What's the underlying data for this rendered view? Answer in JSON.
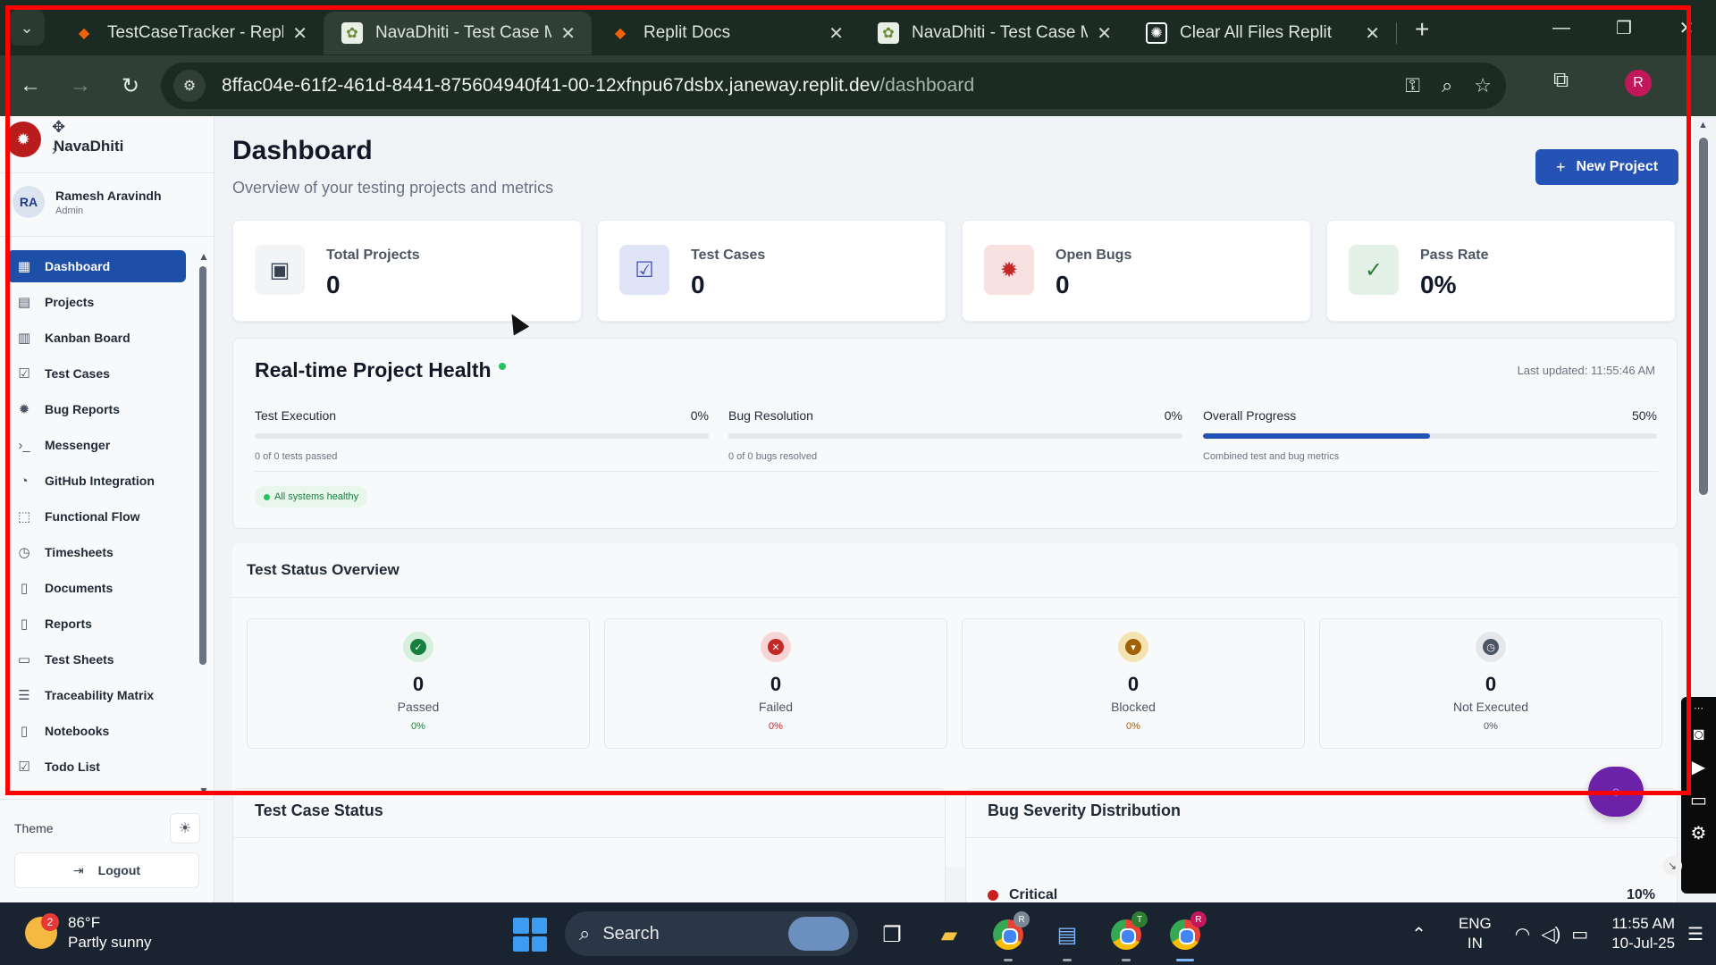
{
  "browser": {
    "tabs": [
      {
        "title": "TestCaseTracker - Replit",
        "favicon": "replit-icon",
        "active": false
      },
      {
        "title": "NavaDhiti - Test Case Ma",
        "favicon": "navadhiti-icon",
        "active": true
      },
      {
        "title": "Replit Docs",
        "favicon": "replit-icon",
        "active": false
      },
      {
        "title": "NavaDhiti - Test Case Ma",
        "favicon": "navadhiti-icon",
        "active": false
      },
      {
        "title": "Clear All Files Replit",
        "favicon": "chatgpt-icon",
        "active": false
      }
    ],
    "url_host": "8ffac04e-61f2-461d-8441-875604940f41-00-12xfnpu67dsbx.janeway.replit.dev",
    "url_path": "/dashboard",
    "profile_initial": "R"
  },
  "sidebar": {
    "brand": "NavaDhiti",
    "user": {
      "initials": "RA",
      "name": "Ramesh Aravindh",
      "role": "Admin"
    },
    "items": [
      {
        "label": "Dashboard",
        "icon": "grid-icon",
        "active": true
      },
      {
        "label": "Projects",
        "icon": "folder-icon"
      },
      {
        "label": "Kanban Board",
        "icon": "kanban-icon"
      },
      {
        "label": "Test Cases",
        "icon": "checkbox-icon"
      },
      {
        "label": "Bug Reports",
        "icon": "bug-icon"
      },
      {
        "label": "Messenger",
        "icon": "terminal-icon"
      },
      {
        "label": "GitHub Integration",
        "icon": "github-icon"
      },
      {
        "label": "Functional Flow",
        "icon": "flow-icon"
      },
      {
        "label": "Timesheets",
        "icon": "clock-icon"
      },
      {
        "label": "Documents",
        "icon": "document-icon"
      },
      {
        "label": "Reports",
        "icon": "report-icon"
      },
      {
        "label": "Test Sheets",
        "icon": "sheet-icon"
      },
      {
        "label": "Traceability Matrix",
        "icon": "filter-icon"
      },
      {
        "label": "Notebooks",
        "icon": "notebook-icon"
      },
      {
        "label": "Todo List",
        "icon": "todo-icon"
      }
    ],
    "theme_label": "Theme",
    "logout_label": "Logout"
  },
  "dashboard": {
    "title": "Dashboard",
    "subtitle": "Overview of your testing projects and metrics",
    "new_project_label": "New Project",
    "stats": [
      {
        "label": "Total Projects",
        "value": "0",
        "icon": "folder-chart-icon",
        "bg": "#f3f4f6",
        "fg": "#374151"
      },
      {
        "label": "Test Cases",
        "value": "0",
        "icon": "checkbox-icon",
        "bg": "#e0e4f7",
        "fg": "#3f51b5"
      },
      {
        "label": "Open Bugs",
        "value": "0",
        "icon": "bug-icon",
        "bg": "#f8e1e1",
        "fg": "#c62828"
      },
      {
        "label": "Pass Rate",
        "value": "0%",
        "icon": "check-circle-icon",
        "bg": "#e3f1e7",
        "fg": "#2e7d32"
      }
    ],
    "health": {
      "title": "Real-time Project Health",
      "last_updated": "Last updated: 11:55:46 AM",
      "metrics": [
        {
          "label": "Test Execution",
          "percent_text": "0%",
          "progress": 0,
          "caption": "0 of 0 tests passed"
        },
        {
          "label": "Bug Resolution",
          "percent_text": "0%",
          "progress": 0,
          "caption": "0 of 0 bugs resolved"
        },
        {
          "label": "Overall Progress",
          "percent_text": "50%",
          "progress": 0.5,
          "caption": "Combined test and bug metrics"
        }
      ],
      "status_badge": "All systems healthy"
    },
    "test_status": {
      "title": "Test Status Overview",
      "items": [
        {
          "label": "Passed",
          "count": "0",
          "percent": "0%",
          "icon": "check-icon",
          "ring": "#d7efdd",
          "dot": "#15803d",
          "pct_color": "#15803d"
        },
        {
          "label": "Failed",
          "count": "0",
          "percent": "0%",
          "icon": "x-icon",
          "ring": "#f5d5d5",
          "dot": "#c62828",
          "pct_color": "#c62828"
        },
        {
          "label": "Blocked",
          "count": "0",
          "percent": "0%",
          "icon": "blocked-icon",
          "ring": "#f3e3b0",
          "dot": "#a16207",
          "pct_color": "#a16207"
        },
        {
          "label": "Not Executed",
          "count": "0",
          "percent": "0%",
          "icon": "clock-icon",
          "ring": "#e5e7eb",
          "dot": "#4b5563",
          "pct_color": "#4b5563"
        }
      ]
    },
    "test_case_status_title": "Test Case Status",
    "bug_severity": {
      "title": "Bug Severity Distribution",
      "rows": [
        {
          "label": "Critical",
          "percent": "10%",
          "color": "#c81e1e"
        }
      ]
    }
  },
  "taskbar": {
    "weather_temp": "86°F",
    "weather_desc": "Partly sunny",
    "weather_badge": "2",
    "search_label": "Search",
    "lang_top": "ENG",
    "lang_bottom": "IN",
    "time": "11:55 AM",
    "date": "10-Jul-25",
    "chrome_badges": [
      "R",
      "T",
      "R"
    ]
  }
}
